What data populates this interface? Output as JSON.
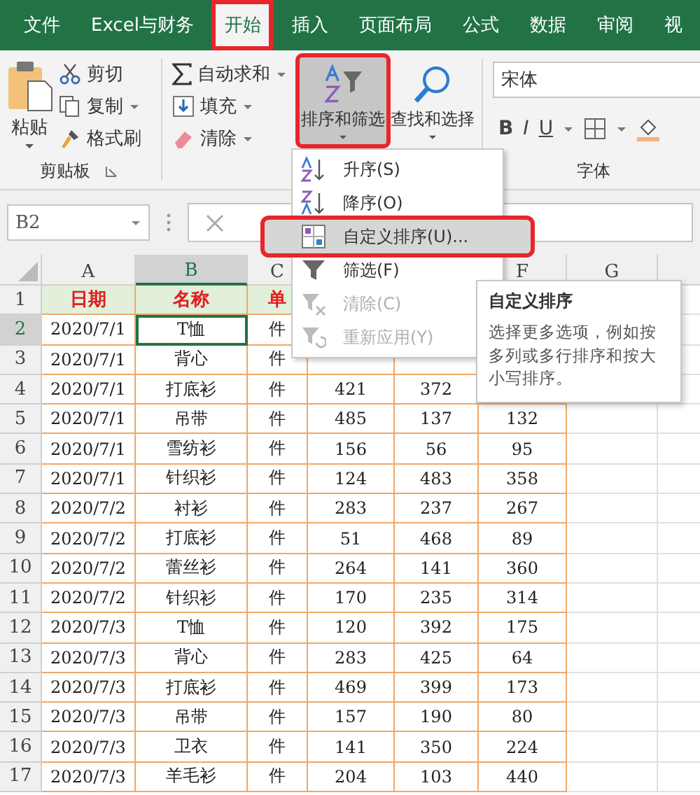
{
  "tabs": [
    {
      "label": "文件",
      "selected": false,
      "highlighted": false
    },
    {
      "label": "Excel与财务",
      "selected": false,
      "highlighted": false
    },
    {
      "label": "开始",
      "selected": true,
      "highlighted": true
    },
    {
      "label": "插入",
      "selected": false,
      "highlighted": false
    },
    {
      "label": "页面布局",
      "selected": false,
      "highlighted": false
    },
    {
      "label": "公式",
      "selected": false,
      "highlighted": false
    },
    {
      "label": "数据",
      "selected": false,
      "highlighted": false
    },
    {
      "label": "审阅",
      "selected": false,
      "highlighted": false
    },
    {
      "label": "视",
      "selected": false,
      "highlighted": false
    }
  ],
  "ribbon": {
    "clipboard": {
      "paste": "粘贴",
      "cut": "剪切",
      "copy": "复制",
      "format_painter": "格式刷",
      "group_label": "剪贴板"
    },
    "editing": {
      "autosum": "自动求和",
      "fill": "填充",
      "clear": "清除"
    },
    "sort_filter": {
      "label": "排序和筛选",
      "pressed": true,
      "highlighted": true
    },
    "find_select": {
      "label": "查找和选择"
    },
    "font": {
      "font_name": "宋体",
      "bold": "B",
      "italic": "I",
      "underline": "U",
      "group_label": "字体"
    }
  },
  "formula_bar": {
    "name_box": "B2"
  },
  "sheet": {
    "columns": [
      {
        "label": "A",
        "selected": false
      },
      {
        "label": "B",
        "selected": true
      },
      {
        "label": "C",
        "selected": false
      },
      {},
      {},
      {
        "label": "F",
        "selected": false
      },
      {
        "label": "G",
        "selected": false
      },
      {
        "selected": false
      }
    ],
    "rows": [
      {
        "number": "1",
        "kind": "header",
        "selected": false,
        "cells": [
          "日期",
          "名称",
          "单"
        ]
      },
      {
        "number": "2",
        "kind": "data",
        "selected": true,
        "cells": [
          "2020/7/1",
          "T恤",
          "件"
        ]
      },
      {
        "number": "3",
        "kind": "data",
        "selected": false,
        "cells": [
          "2020/7/1",
          "背心",
          "件"
        ]
      },
      {
        "number": "4",
        "kind": "data",
        "selected": false,
        "cells": [
          "2020/7/1",
          "打底衫",
          "件",
          "421",
          "372"
        ]
      },
      {
        "number": "5",
        "kind": "data",
        "selected": false,
        "cells": [
          "2020/7/1",
          "吊带",
          "件",
          "485",
          "137",
          "132"
        ]
      },
      {
        "number": "6",
        "kind": "data",
        "selected": false,
        "cells": [
          "2020/7/1",
          "雪纺衫",
          "件",
          "156",
          "56",
          "95"
        ]
      },
      {
        "number": "7",
        "kind": "data",
        "selected": false,
        "cells": [
          "2020/7/1",
          "针织衫",
          "件",
          "124",
          "483",
          "358"
        ]
      },
      {
        "number": "8",
        "kind": "data",
        "selected": false,
        "cells": [
          "2020/7/2",
          "衬衫",
          "件",
          "283",
          "237",
          "267"
        ]
      },
      {
        "number": "9",
        "kind": "data",
        "selected": false,
        "cells": [
          "2020/7/2",
          "打底衫",
          "件",
          "51",
          "468",
          "89"
        ]
      },
      {
        "number": "10",
        "kind": "data",
        "selected": false,
        "cells": [
          "2020/7/2",
          "蕾丝衫",
          "件",
          "264",
          "141",
          "360"
        ]
      },
      {
        "number": "11",
        "kind": "data",
        "selected": false,
        "cells": [
          "2020/7/2",
          "针织衫",
          "件",
          "170",
          "235",
          "314"
        ]
      },
      {
        "number": "12",
        "kind": "data",
        "selected": false,
        "cells": [
          "2020/7/3",
          "T恤",
          "件",
          "120",
          "392",
          "175"
        ]
      },
      {
        "number": "13",
        "kind": "data",
        "selected": false,
        "cells": [
          "2020/7/3",
          "背心",
          "件",
          "283",
          "425",
          "64"
        ]
      },
      {
        "number": "14",
        "kind": "data",
        "selected": false,
        "cells": [
          "2020/7/3",
          "打底衫",
          "件",
          "469",
          "399",
          "173"
        ]
      },
      {
        "number": "15",
        "kind": "data",
        "selected": false,
        "cells": [
          "2020/7/3",
          "吊带",
          "件",
          "157",
          "190",
          "80"
        ]
      },
      {
        "number": "16",
        "kind": "data",
        "selected": false,
        "cells": [
          "2020/7/3",
          "卫衣",
          "件",
          "141",
          "350",
          "224"
        ]
      },
      {
        "number": "17",
        "kind": "data",
        "selected": false,
        "cells": [
          "2020/7/3",
          "羊毛衫",
          "件",
          "204",
          "103",
          "440"
        ]
      }
    ]
  },
  "menu": {
    "items": [
      {
        "label": "升序(S)",
        "kind": "ascending",
        "disabled": false,
        "selected": false,
        "highlighted": false
      },
      {
        "label": "降序(O)",
        "kind": "descending",
        "disabled": false,
        "selected": false,
        "highlighted": false
      },
      {
        "label": "自定义排序(U)...",
        "kind": "custom",
        "disabled": false,
        "selected": true,
        "highlighted": true
      },
      {
        "label": "筛选(F)",
        "kind": "filter",
        "disabled": false,
        "selected": false,
        "highlighted": false
      },
      {
        "label": "清除(C)",
        "kind": "clear",
        "disabled": true,
        "selected": false,
        "highlighted": false
      },
      {
        "label": "重新应用(Y)",
        "kind": "reapply",
        "disabled": true,
        "selected": false,
        "highlighted": false
      }
    ]
  },
  "tooltip": {
    "title": "自定义排序",
    "text": "选择更多选项，例如按多列或多行排序和按大小写排序。"
  }
}
